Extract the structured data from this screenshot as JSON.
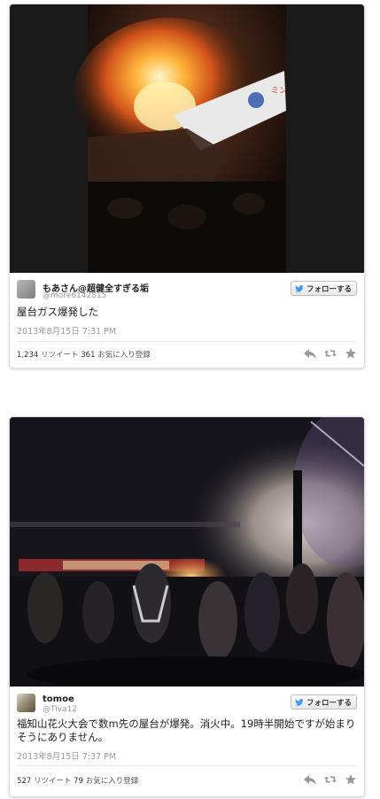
{
  "tweets": [
    {
      "name": "もあさん@超健全すぎる垢",
      "handle": "@more6142815",
      "follow_label": "フォローする",
      "text": "屋台ガス爆発した",
      "timestamp": "2013年8月15日 7:31 PM",
      "retweets": "1,234",
      "retweet_label": "リツイート",
      "favorites": "361",
      "favorite_label": "お気に入り登録"
    },
    {
      "name": "tomoe",
      "handle": "@Tiva12",
      "follow_label": "フォローする",
      "text": "福知山花火大会で数m先の屋台が爆発。消火中。19時半開始ですが始まりそうにありません。",
      "timestamp": "2013年8月15日 7:37 PM",
      "retweets": "527",
      "retweet_label": "リツイート",
      "favorites": "79",
      "favorite_label": "お気に入り登録"
    }
  ],
  "colors": {
    "twitter_blue": "#4099ff",
    "action_gray": "#999999"
  },
  "icons": [
    "twitter-bird-icon",
    "reply-icon",
    "retweet-icon",
    "favorite-star-icon"
  ]
}
